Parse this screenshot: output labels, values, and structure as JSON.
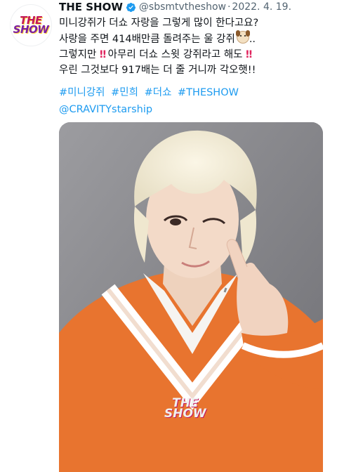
{
  "account": {
    "name": "THE SHOW",
    "handle": "@sbsmtvtheshow",
    "separator": "·",
    "date": "2022. 4. 19.",
    "avatar_logo_line1": "THE",
    "avatar_logo_line2": "SHOW"
  },
  "tweet": {
    "line1": "미니강쥐가 더쇼 자랑을 그렇게 많이 한다고요?",
    "line2_text": "사랑을 주면 414배만큼 돌려주는 울 강쥐",
    "line2_suffix": "..",
    "line3_part1": "그렇지만 ",
    "line3_part2": " 아무리 더쇼 스윗 강쥐라고 해도 ",
    "line4": "우린 그것보다 917배는 더 줄 거니까 각오햇!!",
    "exclaim": "‼",
    "dog_emoji": "dog-face-emoji"
  },
  "hashtags": [
    "#미니강쥐",
    "#민희",
    "#더쇼",
    "#THESHOW"
  ],
  "mention": "@CRAVITYstarship",
  "photo": {
    "watermark_line1": "THE",
    "watermark_line2": "SHOW"
  },
  "colors": {
    "link": "#1d9bf0",
    "verified": "#1d9bf0",
    "sweater": "#e8742f"
  }
}
